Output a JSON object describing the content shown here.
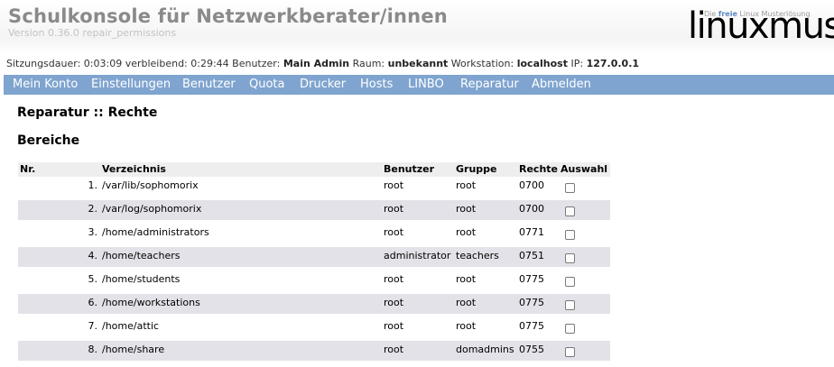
{
  "header": {
    "title": "Schulkonsole für Netzwerkberater/innen",
    "version": "Version 0.36.0 repair_permissions",
    "logo": {
      "tagline_pre": "Die",
      "tagline_free": "freie",
      "tagline_post": "Linux Musterlösung",
      "wordmark": "linuxmuster"
    }
  },
  "session": {
    "duration_label": "Sitzungsdauer:",
    "duration": "0:03:09",
    "remaining_label": "verbleibend:",
    "remaining": "0:29:44",
    "user_label": "Benutzer:",
    "user": "Main Admin",
    "room_label": "Raum:",
    "room": "unbekannt",
    "workstation_label": "Workstation:",
    "workstation": "localhost",
    "ip_label": "IP:",
    "ip": "127.0.0.1"
  },
  "nav": [
    "Mein Konto",
    "Einstellungen",
    "Benutzer",
    "Quota",
    "Drucker",
    "Hosts",
    "LINBO",
    "Reparatur",
    "Abmelden"
  ],
  "page": {
    "heading": "Reparatur :: Rechte",
    "section": "Bereiche"
  },
  "table": {
    "columns": [
      "Nr.",
      "Verzeichnis",
      "Benutzer",
      "Gruppe",
      "Rechte",
      "Auswahl"
    ],
    "rows": [
      {
        "nr": "1.",
        "dir": "/var/lib/sophomorix",
        "user": "root",
        "group": "root",
        "perm": "0700",
        "checked": false
      },
      {
        "nr": "2.",
        "dir": "/var/log/sophomorix",
        "user": "root",
        "group": "root",
        "perm": "0700",
        "checked": false
      },
      {
        "nr": "3.",
        "dir": "/home/administrators",
        "user": "root",
        "group": "root",
        "perm": "0771",
        "checked": false
      },
      {
        "nr": "4.",
        "dir": "/home/teachers",
        "user": "administrator",
        "group": "teachers",
        "perm": "0751",
        "checked": false
      },
      {
        "nr": "5.",
        "dir": "/home/students",
        "user": "root",
        "group": "root",
        "perm": "0775",
        "checked": false
      },
      {
        "nr": "6.",
        "dir": "/home/workstations",
        "user": "root",
        "group": "root",
        "perm": "0775",
        "checked": false
      },
      {
        "nr": "7.",
        "dir": "/home/attic",
        "user": "root",
        "group": "root",
        "perm": "0775",
        "checked": false
      },
      {
        "nr": "8.",
        "dir": "/home/share",
        "user": "root",
        "group": "domadmins",
        "perm": "0755",
        "checked": false
      }
    ]
  },
  "colors": {
    "nav_bg": "#7fa4cf",
    "row_alt": "#e2e2e8",
    "header_bg": "#eeeeee",
    "title": "#8a8a8a"
  }
}
